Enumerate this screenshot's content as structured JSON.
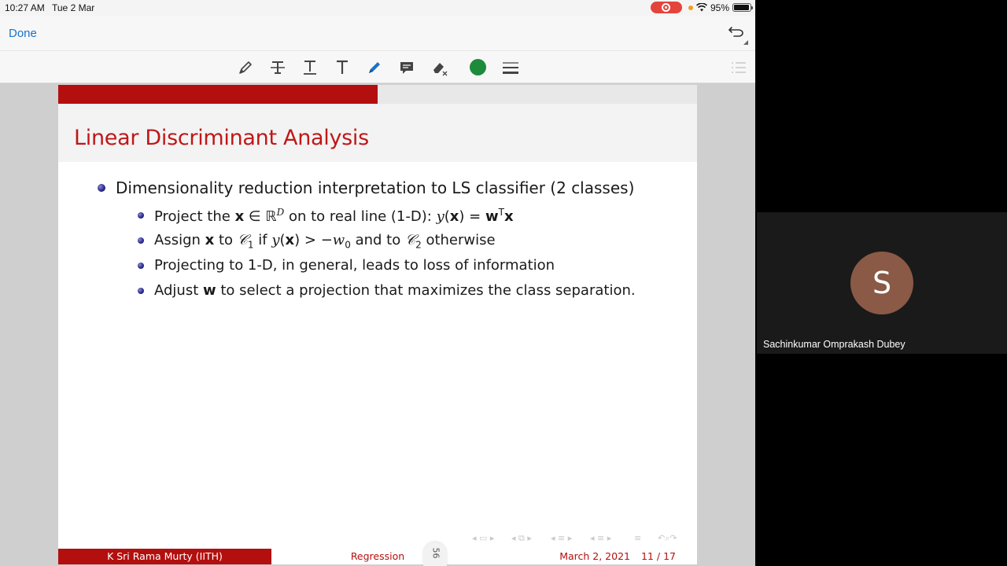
{
  "status_bar": {
    "time": "10:27 AM",
    "date": "Tue 2 Mar",
    "battery_percent": "95%",
    "battery_level": 0.95,
    "recording": true
  },
  "nav": {
    "done_label": "Done",
    "undo_icon": "undo-arrow-icon"
  },
  "toolbar": {
    "tools": [
      "pen-icon",
      "strikethrough-text-icon",
      "underline-text-icon",
      "text-icon",
      "highlighter-icon",
      "comment-icon",
      "eraser-icon",
      "color-picker",
      "line-weight-icon"
    ],
    "selected_tool": "highlighter-icon",
    "color": "#1e8a3b",
    "accent": "#1a73c9"
  },
  "slide": {
    "progress": 0.5,
    "title": "Linear Discriminant Analysis",
    "bullet_main": "Dimensionality reduction interpretation to LS classifier (2 classes)",
    "sub1": {
      "pre": "Project the ",
      "x": "x",
      "in": " ∈ ",
      "R": "ℝ",
      "D": "D",
      "mid": " on to real line (1-D): ",
      "y": "y",
      "paren_open": "(",
      "x2": "x",
      "eq": ") = ",
      "w": "w",
      "T": "T",
      "x3": "x"
    },
    "sub2": {
      "pre": "Assign ",
      "x": "x",
      "to": " to ",
      "C": "𝒞",
      "one": "1",
      "if": " if ",
      "y": "y",
      "po": "(",
      "x2": "x",
      "gt": ") > −",
      "w": "w",
      "zero": "0",
      "and": " and to ",
      "C2": "𝒞",
      "two": "2",
      "otherwise": " otherwise"
    },
    "sub3": "Projecting to 1-D, in general, leads to loss of information",
    "sub4": {
      "pre": "Adjust ",
      "w": "w",
      "post": " to select a projection that maximizes the class separation."
    },
    "footer": {
      "author": "K Sri Rama Murty  (IITH)",
      "title": "Regression",
      "date": "March 2, 2021",
      "page": "11 / 17"
    },
    "brand_red": "#b30f0f"
  },
  "page_tab": "56",
  "participant": {
    "initial": "S",
    "name": "Sachinkumar Omprakash Dubey",
    "avatar_color": "#8a5a46"
  }
}
